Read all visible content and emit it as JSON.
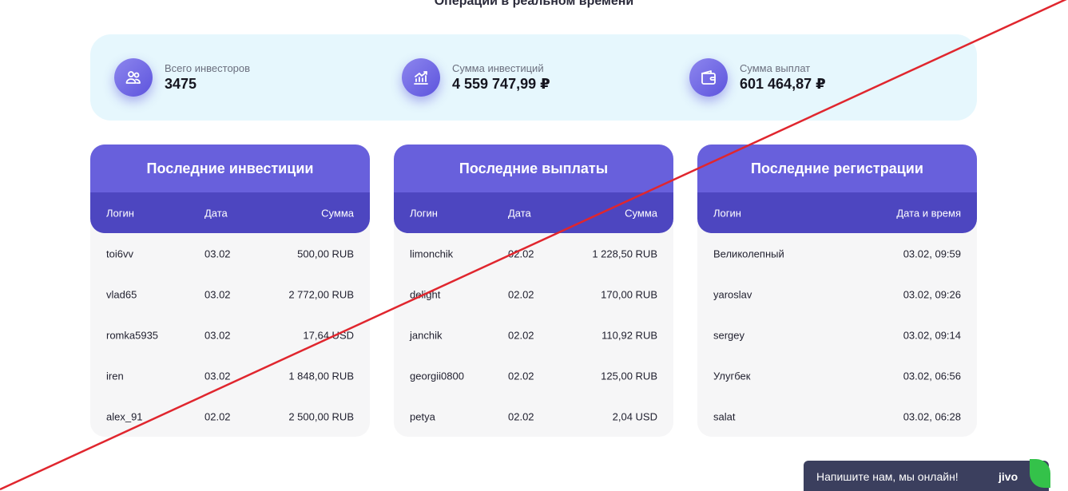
{
  "page": {
    "title": "Операции в реальном времени"
  },
  "stats": [
    {
      "label": "Всего инвесторов",
      "value": "3475",
      "icon": "users-icon"
    },
    {
      "label": "Сумма инвестиций",
      "value": "4 559 747,99 ₽",
      "icon": "chart-growth-icon"
    },
    {
      "label": "Сумма выплат",
      "value": "601 464,87 ₽",
      "icon": "wallet-icon"
    }
  ],
  "investments": {
    "title": "Последние инвестиции",
    "columns": [
      "Логин",
      "Дата",
      "Сумма"
    ],
    "rows": [
      {
        "login": "toi6vv",
        "date": "03.02",
        "amount": "500,00 RUB"
      },
      {
        "login": "vlad65",
        "date": "03.02",
        "amount": "2 772,00 RUB"
      },
      {
        "login": "romka5935",
        "date": "03.02",
        "amount": "17,64 USD"
      },
      {
        "login": "iren",
        "date": "03.02",
        "amount": "1 848,00 RUB"
      },
      {
        "login": "alex_91",
        "date": "02.02",
        "amount": "2 500,00 RUB"
      }
    ]
  },
  "payouts": {
    "title": "Последние выплаты",
    "columns": [
      "Логин",
      "Дата",
      "Сумма"
    ],
    "rows": [
      {
        "login": "limonchik",
        "date": "02.02",
        "amount": "1 228,50 RUB"
      },
      {
        "login": "delight",
        "date": "02.02",
        "amount": "170,00 RUB"
      },
      {
        "login": "janchik",
        "date": "02.02",
        "amount": "110,92 RUB"
      },
      {
        "login": "georgii0800",
        "date": "02.02",
        "amount": "125,00 RUB"
      },
      {
        "login": "petya",
        "date": "02.02",
        "amount": "2,04 USD"
      }
    ]
  },
  "registrations": {
    "title": "Последние регистрации",
    "columns": [
      "Логин",
      "Дата и время"
    ],
    "rows": [
      {
        "login": "Великолепный",
        "datetime": "03.02, 09:59"
      },
      {
        "login": "yaroslav",
        "datetime": "03.02, 09:26"
      },
      {
        "login": "sergey",
        "datetime": "03.02, 09:14"
      },
      {
        "login": "Улугбек",
        "datetime": "03.02, 06:56"
      },
      {
        "login": "salat",
        "datetime": "03.02, 06:28"
      }
    ]
  },
  "chat": {
    "prompt": "Напишите нам, мы онлайн!",
    "brand": "jivo"
  },
  "colors": {
    "accent": "#6860dc",
    "accent_dark": "#4d46c0",
    "stats_bg": "#e6f7fd",
    "overlay_line": "#e0262e"
  }
}
